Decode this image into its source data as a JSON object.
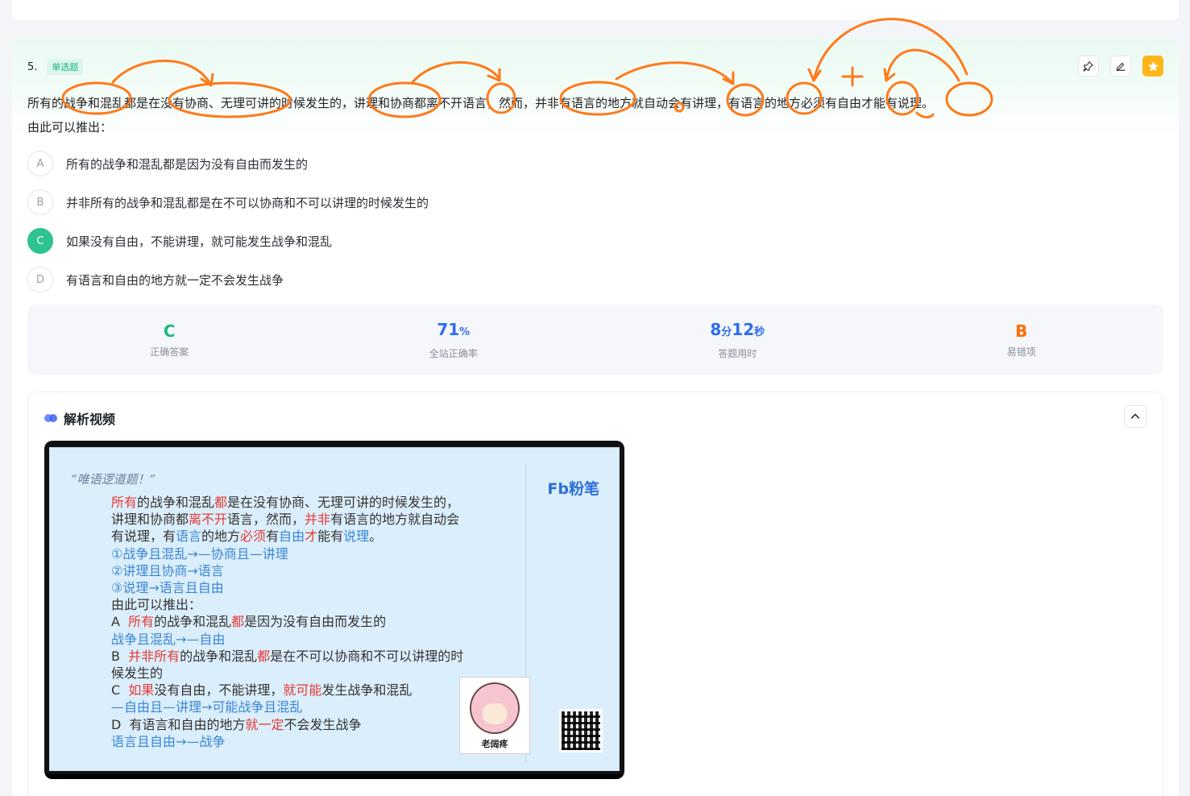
{
  "question": {
    "number": "5.",
    "type": "单选题",
    "stem_line1": "所有的战争和混乱都是在没有协商、无理可讲的时候发生的，讲理和协商都离不开语言，然而，并非有语言的地方就自动会有讲理，有语言的地方必须有自由才能有说理。",
    "stem_line2": "由此可以推出：",
    "options": [
      {
        "letter": "A",
        "text": "所有的战争和混乱都是因为没有自由而发生的"
      },
      {
        "letter": "B",
        "text": "并非所有的战争和混乱都是在不可以协商和不可以讲理的时候发生的"
      },
      {
        "letter": "C",
        "text": "如果没有自由，不能讲理，就可能发生战争和混乱"
      },
      {
        "letter": "D",
        "text": "有语言和自由的地方就一定不会发生战争"
      }
    ],
    "selected": "C"
  },
  "stats": {
    "answer": {
      "value": "C",
      "label": "正确答案"
    },
    "rate": {
      "value": "71",
      "unit": "%",
      "label": "全站正确率"
    },
    "time": {
      "min": "8",
      "min_unit": "分",
      "sec": "12",
      "sec_unit": "秒",
      "label": "答题用时"
    },
    "wrong": {
      "value": "B",
      "label": "易错项"
    }
  },
  "video": {
    "title": "解析视频",
    "slide": {
      "handwriting": "“唯语逻道题！”",
      "logo": "Fb粉笔",
      "avatar_name": "老阔疼"
    }
  },
  "colors": {
    "green": "#1cb87e",
    "blue": "#2f6cf0",
    "orange": "#ff6a00",
    "annotation": "#ff7a1a"
  },
  "icons": [
    "pin-icon",
    "edit-icon",
    "star-icon",
    "chevron-up-icon"
  ]
}
